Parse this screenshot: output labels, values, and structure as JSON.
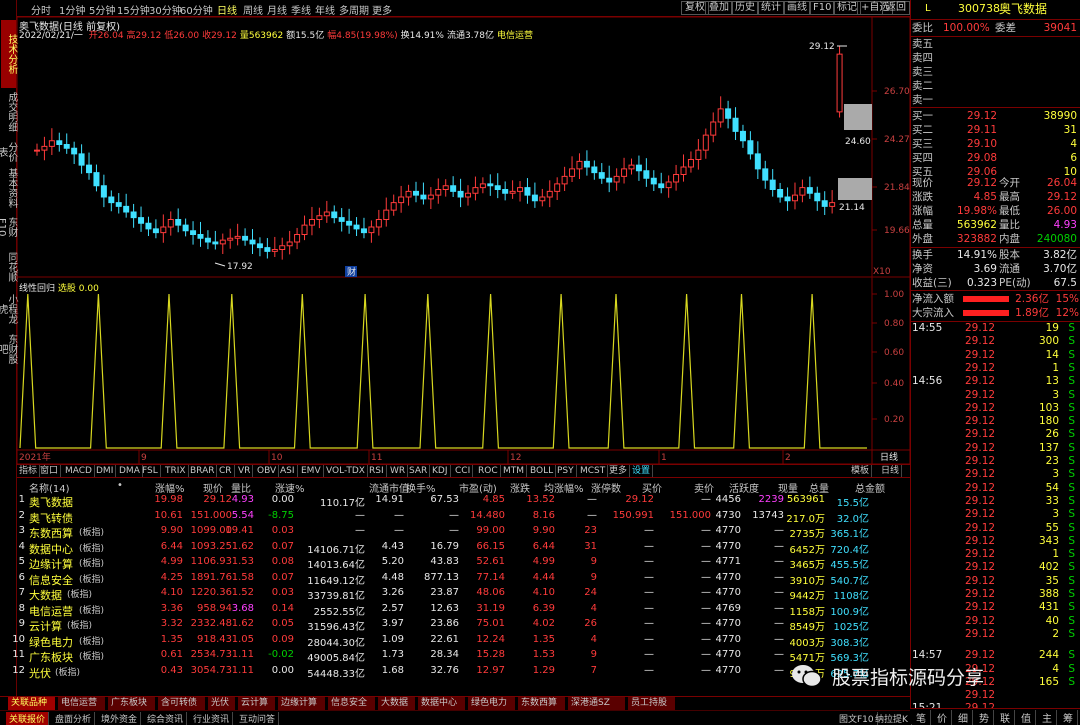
{
  "left_tabs": [
    "技术分析",
    "成交明细",
    "分价表",
    "基本资料",
    "东财F10",
    "同花顺",
    "小程龙虎",
    "东财股吧"
  ],
  "toolbar": {
    "periods": [
      "分时",
      "1分钟",
      "5分钟",
      "15分钟",
      "30分钟",
      "60分钟",
      "日线",
      "周线",
      "月线",
      "季线",
      "年线",
      "多周期",
      "更多"
    ],
    "selected": "日线",
    "right": [
      "复权",
      "叠加",
      "历史",
      "统计",
      "画线",
      "F10",
      "标记",
      "+自选",
      "返回"
    ]
  },
  "chart": {
    "title": "奥飞数据(日线 前复权)",
    "info_date": "2022/02/21/一",
    "info": [
      {
        "t": "开26.04",
        "c": "red"
      },
      {
        "t": "高29.12",
        "c": "red"
      },
      {
        "t": "低26.00",
        "c": "red"
      },
      {
        "t": "收29.12",
        "c": "red"
      },
      {
        "t": "量563962",
        "c": "yel"
      },
      {
        "t": "额15.5亿",
        "c": "wht"
      },
      {
        "t": "幅4.85(19.98%)",
        "c": "red"
      },
      {
        "t": "换14.91%",
        "c": "wht"
      },
      {
        "t": "流通3.78亿",
        "c": "wht"
      },
      {
        "t": "电信运营",
        "c": "yel"
      }
    ],
    "price_axis": [
      "26.70",
      "24.27",
      "21.84",
      "19.66"
    ],
    "annot_high": "29.12",
    "annot_low": "17.92",
    "annot_mid": "24.60",
    "annot_right": "21.14",
    "mark_cai": "财",
    "x10": "X10",
    "ind_title": "线性回归",
    "ind_label": "选股",
    "ind_value": "0.00",
    "ind_axis": [
      "1.00",
      "0.80",
      "0.60",
      "0.40",
      "0.20"
    ],
    "date_labels": [
      "2021年",
      "9",
      "10",
      "11",
      "12",
      "1",
      "2"
    ],
    "day_label": "日线"
  },
  "chart_data": {
    "type": "line",
    "title": "线性回归",
    "series": [
      {
        "name": "选股",
        "values": [
          0,
          1,
          0,
          0,
          0,
          0,
          0,
          0,
          0,
          0,
          1,
          0,
          0,
          0,
          0,
          0,
          0,
          0,
          0,
          1,
          0,
          0,
          0,
          0,
          0,
          0,
          0,
          1,
          0,
          0,
          0,
          0,
          0,
          0,
          0,
          0,
          1,
          0,
          0,
          0,
          0,
          0,
          0,
          0,
          1,
          0,
          0,
          0,
          0,
          0,
          0,
          0,
          1,
          0,
          0,
          0,
          0,
          0,
          0,
          0,
          1,
          0,
          0,
          0,
          0,
          0,
          0,
          0,
          0,
          1,
          0,
          0,
          0,
          0,
          0,
          0,
          1,
          0,
          0,
          0,
          0,
          0,
          0,
          0,
          0,
          1,
          0,
          0,
          0,
          0,
          0,
          0,
          1,
          0,
          0,
          0,
          0,
          0,
          0,
          0,
          0,
          1,
          0,
          0,
          0,
          0,
          0,
          0,
          0
        ]
      }
    ],
    "ylim": [
      0,
      1
    ]
  },
  "ind_tabs": [
    "指标",
    "窗口",
    "MACD",
    "DMI",
    "DMA",
    "FSL",
    "TRIX",
    "BRAR",
    "CR",
    "VR",
    "OBV",
    "ASI",
    "EMV",
    "VOL-TDX",
    "RSI",
    "WR",
    "SAR",
    "KDJ",
    "CCI",
    "ROC",
    "MTM",
    "BOLL",
    "PSY",
    "MCST",
    "更多",
    "设置"
  ],
  "ind_tabs_right": [
    "模板",
    "日线"
  ],
  "table": {
    "headers": [
      "名称(14)",
      "•",
      "涨幅%",
      "现价",
      "量比",
      "涨速%",
      "流通市值",
      "换手%",
      "市盈(动)",
      "涨跌",
      "均涨幅%",
      "涨停数",
      "买价",
      "卖价",
      "活跃度",
      "现量",
      "总量",
      "总金额"
    ],
    "rows": [
      {
        "n": "1",
        "name": "奥飞数据",
        "tag": "",
        "c": [
          "19.98",
          "29.12",
          "4.93",
          "0.00",
          "110.17亿",
          "14.91",
          "67.53",
          "4.85",
          "13.52",
          "—",
          "29.12",
          "—",
          "4456",
          "2239",
          "563961",
          "15.5亿"
        ]
      },
      {
        "n": "2",
        "name": "奥飞转债",
        "tag": "",
        "c": [
          "10.61",
          "151.000",
          "5.54",
          "-8.75",
          "—",
          "—",
          "—",
          "14.480",
          "8.16",
          "—",
          "150.991",
          "151.000",
          "4730",
          "13743",
          "217.0万",
          "32.0亿"
        ]
      },
      {
        "n": "3",
        "name": "东数西算",
        "tag": "(板指)",
        "c": [
          "9.90",
          "1099.00",
          "19.41",
          "0.03",
          "—",
          "—",
          "—",
          "99.00",
          "9.90",
          "23",
          "—",
          "—",
          "4770",
          "—",
          "2735万",
          "365.1亿"
        ]
      },
      {
        "n": "4",
        "name": "数据中心",
        "tag": "(板指)",
        "c": [
          "6.44",
          "1093.25",
          "1.62",
          "0.07",
          "14106.71亿",
          "4.43",
          "16.79",
          "66.15",
          "6.44",
          "31",
          "—",
          "—",
          "4770",
          "—",
          "6452万",
          "720.4亿"
        ]
      },
      {
        "n": "5",
        "name": "边缘计算",
        "tag": "(板指)",
        "c": [
          "4.99",
          "1106.93",
          "1.53",
          "0.08",
          "14013.64亿",
          "5.20",
          "43.83",
          "52.61",
          "4.99",
          "9",
          "—",
          "—",
          "4771",
          "—",
          "3465万",
          "455.5亿"
        ]
      },
      {
        "n": "6",
        "name": "信息安全",
        "tag": "(板指)",
        "c": [
          "4.25",
          "1891.76",
          "1.58",
          "0.07",
          "11649.12亿",
          "4.48",
          "877.13",
          "77.14",
          "4.44",
          "9",
          "—",
          "—",
          "4770",
          "—",
          "3910万",
          "540.7亿"
        ]
      },
      {
        "n": "7",
        "name": "大数据",
        "tag": "(板指)",
        "c": [
          "4.10",
          "1220.36",
          "1.52",
          "0.03",
          "33739.81亿",
          "3.26",
          "23.87",
          "48.06",
          "4.10",
          "24",
          "—",
          "—",
          "4770",
          "—",
          "9442万",
          "1108亿"
        ]
      },
      {
        "n": "8",
        "name": "电信运营",
        "tag": "(板指)",
        "c": [
          "3.36",
          "958.94",
          "3.68",
          "0.14",
          "2552.55亿",
          "2.57",
          "12.63",
          "31.19",
          "6.39",
          "4",
          "—",
          "—",
          "4769",
          "—",
          "1158万",
          "100.9亿"
        ]
      },
      {
        "n": "9",
        "name": "云计算",
        "tag": "(板指)",
        "c": [
          "3.32",
          "2332.48",
          "1.62",
          "0.05",
          "31596.43亿",
          "3.97",
          "23.86",
          "75.01",
          "4.02",
          "26",
          "—",
          "—",
          "4770",
          "—",
          "8549万",
          "1025亿"
        ]
      },
      {
        "n": "10",
        "name": "绿色电力",
        "tag": "(板指)",
        "c": [
          "1.35",
          "918.43",
          "1.05",
          "0.09",
          "28044.30亿",
          "1.09",
          "22.61",
          "12.24",
          "1.35",
          "4",
          "—",
          "—",
          "4770",
          "—",
          "4003万",
          "308.3亿"
        ]
      },
      {
        "n": "11",
        "name": "广东板块",
        "tag": "(板指)",
        "c": [
          "0.61",
          "2534.73",
          "1.11",
          "-0.02",
          "49005.84亿",
          "1.73",
          "28.34",
          "15.28",
          "1.53",
          "9",
          "—",
          "—",
          "4770",
          "—",
          "5471万",
          "569.3亿"
        ]
      },
      {
        "n": "12",
        "name": "光伏",
        "tag": "(板指)",
        "c": [
          "0.43",
          "3054.73",
          "1.11",
          "0.00",
          "54448.33亿",
          "1.68",
          "32.76",
          "12.97",
          "1.29",
          "7",
          "—",
          "—",
          "4770",
          "—",
          "9070万",
          "625.7亿"
        ]
      }
    ]
  },
  "bottom_tabs": [
    "关联品种",
    "电信运营",
    "广东板块",
    "含可转债",
    "光伏",
    "云计算",
    "边缘计算",
    "信息安全",
    "大数据",
    "数据中心",
    "绿色电力",
    "东数西算",
    "深港通SZ",
    "员工持股"
  ],
  "bottom_links": [
    "关联报价",
    "盘面分析",
    "境外资金",
    "综合资讯",
    "行业资讯",
    "互动问答",
    "图文F10",
    "纳拉提K"
  ],
  "quote": {
    "code": "300738",
    "name": "奥飞数据",
    "flag": "L",
    "weibi_label": "委比",
    "weibi": "100.00%",
    "weicha_label": "委差",
    "weicha": "39041",
    "sells": [
      {
        "l": "卖五"
      },
      {
        "l": "卖四"
      },
      {
        "l": "卖三"
      },
      {
        "l": "卖二"
      },
      {
        "l": "卖一"
      }
    ],
    "buys": [
      {
        "l": "买一",
        "p": "29.12",
        "v": "38990"
      },
      {
        "l": "买二",
        "p": "29.11",
        "v": "31"
      },
      {
        "l": "买三",
        "p": "29.10",
        "v": "4"
      },
      {
        "l": "买四",
        "p": "29.08",
        "v": "6"
      },
      {
        "l": "买五",
        "p": "29.06",
        "v": "10"
      }
    ],
    "stats": [
      {
        "l1": "现价",
        "v1": "29.12",
        "c1": "red",
        "l2": "今开",
        "v2": "26.04",
        "c2": "red"
      },
      {
        "l1": "涨跌",
        "v1": "4.85",
        "c1": "red",
        "l2": "最高",
        "v2": "29.12",
        "c2": "red"
      },
      {
        "l1": "涨幅",
        "v1": "19.98%",
        "c1": "red",
        "l2": "最低",
        "v2": "26.00",
        "c2": "red"
      },
      {
        "l1": "总量",
        "v1": "563962",
        "c1": "yel",
        "l2": "量比",
        "v2": "4.93",
        "c2": "mag"
      },
      {
        "l1": "外盘",
        "v1": "323882",
        "c1": "red",
        "l2": "内盘",
        "v2": "240080",
        "c2": "green"
      }
    ],
    "stats2": [
      {
        "l1": "换手",
        "v1": "14.91%",
        "l2": "股本",
        "v2": "3.82亿"
      },
      {
        "l1": "净资",
        "v1": "3.69",
        "l2": "流通",
        "v2": "3.70亿"
      },
      {
        "l1": "收益(三)",
        "v1": "0.323",
        "l2": "PE(动)",
        "v2": "67.5"
      }
    ],
    "flows": [
      {
        "l": "净流入额",
        "v": "2.36亿",
        "p": "15%"
      },
      {
        "l": "大宗流入",
        "v": "1.89亿",
        "p": "12%"
      }
    ],
    "ticks": [
      {
        "t": "14:55",
        "p": "29.12",
        "v": "19",
        "s": "S"
      },
      {
        "t": "",
        "p": "29.12",
        "v": "300",
        "s": "S"
      },
      {
        "t": "",
        "p": "29.12",
        "v": "14",
        "s": "S"
      },
      {
        "t": "",
        "p": "29.12",
        "v": "1",
        "s": "S"
      },
      {
        "t": "14:56",
        "p": "29.12",
        "v": "13",
        "s": "S"
      },
      {
        "t": "",
        "p": "29.12",
        "v": "3",
        "s": "S"
      },
      {
        "t": "",
        "p": "29.12",
        "v": "103",
        "s": "S"
      },
      {
        "t": "",
        "p": "29.12",
        "v": "180",
        "s": "S"
      },
      {
        "t": "",
        "p": "29.12",
        "v": "26",
        "s": "S"
      },
      {
        "t": "",
        "p": "29.12",
        "v": "137",
        "s": "S"
      },
      {
        "t": "",
        "p": "29.12",
        "v": "23",
        "s": "S"
      },
      {
        "t": "",
        "p": "29.12",
        "v": "3",
        "s": "S"
      },
      {
        "t": "",
        "p": "29.12",
        "v": "54",
        "s": "S"
      },
      {
        "t": "",
        "p": "29.12",
        "v": "33",
        "s": "S"
      },
      {
        "t": "",
        "p": "29.12",
        "v": "3",
        "s": "S"
      },
      {
        "t": "",
        "p": "29.12",
        "v": "55",
        "s": "S"
      },
      {
        "t": "",
        "p": "29.12",
        "v": "343",
        "s": "S"
      },
      {
        "t": "",
        "p": "29.12",
        "v": "1",
        "s": "S"
      },
      {
        "t": "",
        "p": "29.12",
        "v": "402",
        "s": "S"
      },
      {
        "t": "",
        "p": "29.12",
        "v": "35",
        "s": "S"
      },
      {
        "t": "",
        "p": "29.12",
        "v": "388",
        "s": "S"
      },
      {
        "t": "",
        "p": "29.12",
        "v": "431",
        "s": "S"
      },
      {
        "t": "",
        "p": "29.12",
        "v": "40",
        "s": "S"
      },
      {
        "t": "",
        "p": "29.12",
        "v": "2",
        "s": "S"
      },
      {
        "t": "14:57",
        "p": "29.12",
        "v": "244",
        "s": "S"
      },
      {
        "t": "",
        "p": "29.12",
        "v": "4",
        "s": "S"
      },
      {
        "t": "",
        "p": "29.12",
        "v": "165",
        "s": "S"
      },
      {
        "t": "",
        "p": "29.12",
        "v": "",
        "s": ""
      },
      {
        "t": "15:21",
        "p": "29.12",
        "v": "",
        "s": ""
      }
    ],
    "foot": [
      "笔",
      "价",
      "细",
      "势",
      "联",
      "值",
      "主",
      "筹"
    ]
  },
  "watermark": "股票指标源码分享"
}
